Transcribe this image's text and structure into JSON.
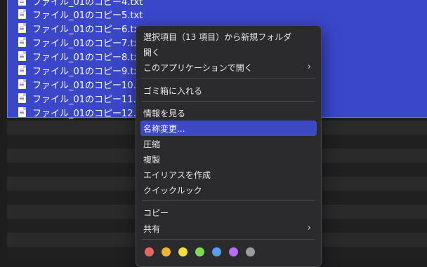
{
  "files": [
    "ファイル_01のコピー4.txt",
    "ファイル_01のコピー5.txt",
    "ファイル_01のコピー6.txt",
    "ファイル_01のコピー7.txt",
    "ファイル_01のコピー8.txt",
    "ファイル_01のコピー9.txt",
    "ファイル_01のコピー10.txt",
    "ファイル_01のコピー11.txt",
    "ファイル_01のコピー12.txt"
  ],
  "menu": {
    "new_folder": "選択項目（13 項目）から新規フォルダ",
    "open": "開く",
    "open_with": "このアプリケーションで開く",
    "trash": "ゴミ箱に入れる",
    "get_info": "情報を見る",
    "rename": "名称変更...",
    "compress": "圧縮",
    "duplicate": "複製",
    "make_alias": "エイリアスを作成",
    "quick_look": "クイックルック",
    "copy": "コピー",
    "share": "共有"
  },
  "tag_colors": [
    "#e4685f",
    "#f2b23a",
    "#f6dd3d",
    "#7ed957",
    "#5b9cf6",
    "#b86ef0",
    "#9c9c9c"
  ]
}
